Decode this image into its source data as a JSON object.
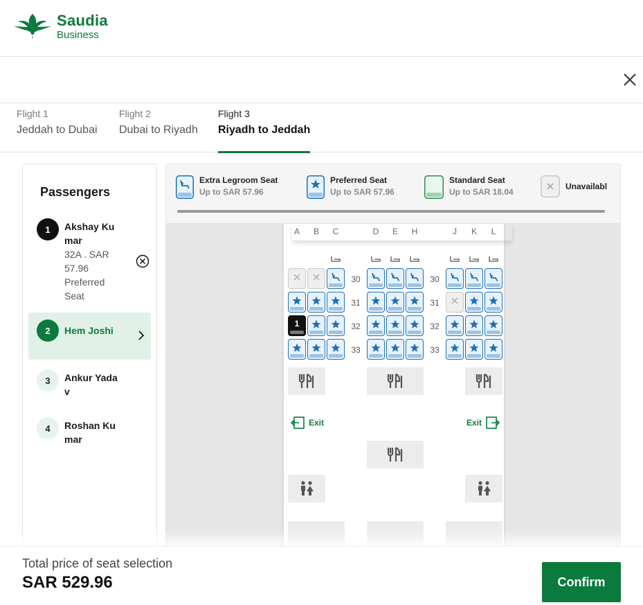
{
  "brand": {
    "name": "Saudia",
    "sub": "Business",
    "color": "#0b7a3d"
  },
  "tabs": [
    {
      "label": "Flight 1",
      "route": "Jeddah to Dubai"
    },
    {
      "label": "Flight 2",
      "route": "Dubai to Riyadh"
    },
    {
      "label": "Flight 3",
      "route": "Riyadh to Jeddah",
      "active": true
    }
  ],
  "passengers": {
    "title": "Passengers",
    "items": [
      {
        "num": "1",
        "name": "Akshay Kumar",
        "detail_seat": "32A . SAR 57.96",
        "detail_type": "Preferred Seat"
      },
      {
        "num": "2",
        "name": "Hem Joshi",
        "selected": true
      },
      {
        "num": "3",
        "name": "Ankur Yadav"
      },
      {
        "num": "4",
        "name": "Roshan Kumar"
      }
    ]
  },
  "legend": [
    {
      "title": "Extra Legroom Seat",
      "sub": "Up to SAR 57.96",
      "icon": "legroom-seat-icon"
    },
    {
      "title": "Preferred Seat",
      "sub": "Up to SAR 57.96",
      "icon": "preferred-seat-icon"
    },
    {
      "title": "Standard Seat",
      "sub": "Up to SAR 18.04",
      "icon": "standard-seat-icon"
    },
    {
      "title": "Unavailabl",
      "sub": "",
      "icon": "unavailable-seat-icon"
    }
  ],
  "columns": [
    "A",
    "B",
    "C",
    "D",
    "E",
    "H",
    "J",
    "K",
    "L"
  ],
  "rows": [
    "30",
    "31",
    "32",
    "33"
  ],
  "seats": {
    "30": [
      "unav",
      "unav",
      "legroom",
      "legroom",
      "legroom",
      "legroom",
      "legroom",
      "legroom",
      "legroom"
    ],
    "31": [
      "pref",
      "pref",
      "pref",
      "pref",
      "pref",
      "pref",
      "unav",
      "pref",
      "pref"
    ],
    "32": [
      "sel",
      "pref",
      "pref",
      "pref",
      "pref",
      "pref",
      "pref",
      "pref",
      "pref"
    ],
    "33": [
      "pref",
      "pref",
      "pref",
      "pref",
      "pref",
      "pref",
      "pref",
      "pref",
      "pref"
    ]
  },
  "selected_seat_label": "1",
  "exit_label": "Exit",
  "footer": {
    "total_label": "Total price of seat selection",
    "total_value": "SAR 529.96",
    "confirm_label": "Confirm"
  }
}
